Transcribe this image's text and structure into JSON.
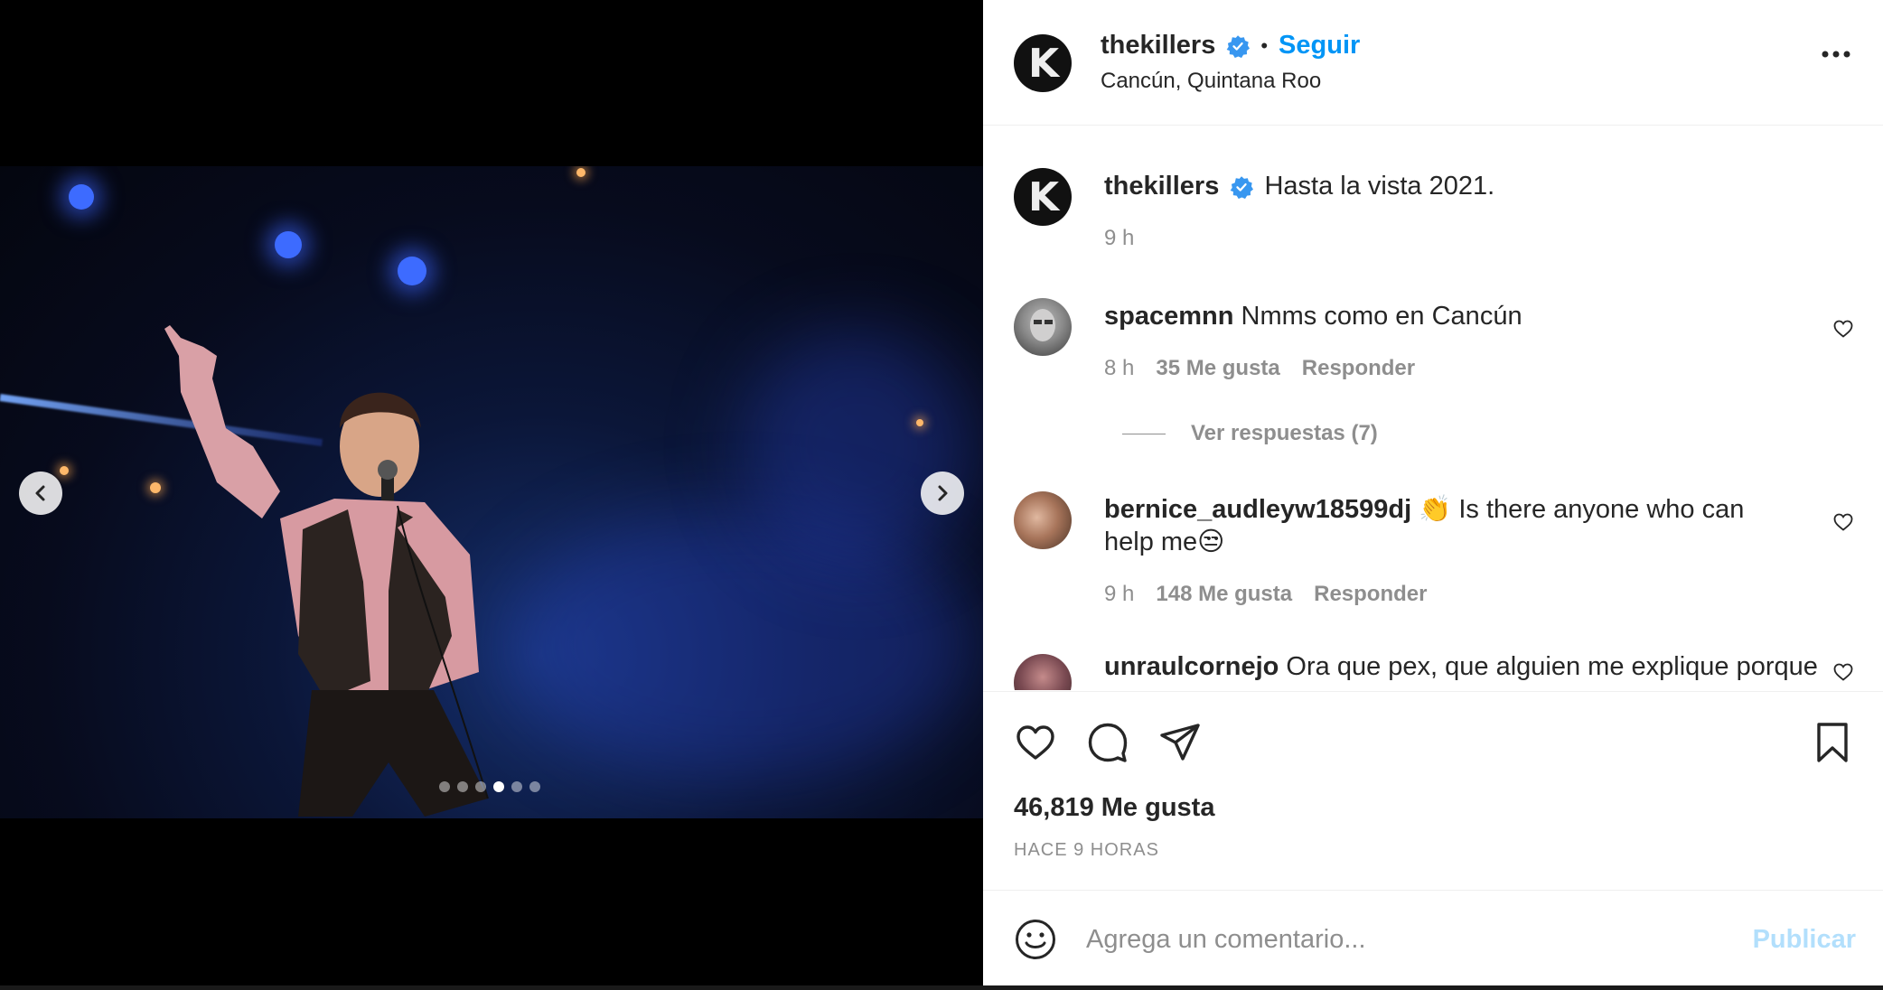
{
  "post": {
    "username": "thekillers",
    "follow_label": "Seguir",
    "separator": "•",
    "location": "Cancún, Quintana Roo",
    "caption": "Hasta la vista 2021.",
    "caption_time": "9 h",
    "avatar_letter": "K",
    "carousel": {
      "total_slides": 6,
      "active_index": 3
    }
  },
  "comments": [
    {
      "username": "spacemnn",
      "text": "Nmms como en Cancún",
      "time": "8 h",
      "likes": "35 Me gusta",
      "reply_label": "Responder",
      "view_replies": "Ver respuestas (7)"
    },
    {
      "username": "bernice_audleyw18599dj",
      "text_prefix": "👏",
      "text": "Is there anyone who can help me😒",
      "time": "9 h",
      "likes": "148 Me gusta",
      "reply_label": "Responder"
    },
    {
      "username": "unraulcornejo",
      "text": "Ora que pex, que alguien me explique porque"
    }
  ],
  "actions": {
    "likes_count": "46,819 Me gusta",
    "time_ago": "HACE 9 HORAS"
  },
  "add_comment": {
    "placeholder": "Agrega un comentario...",
    "publish_label": "Publicar"
  },
  "colors": {
    "accent": "#0095f6",
    "verified": "#3897f0",
    "muted": "#8e8e8e",
    "publish_disabled": "#b2dffc",
    "text": "#262626"
  },
  "icons": [
    "verified-badge-icon",
    "more-options-icon",
    "heart-icon",
    "comment-icon",
    "share-icon",
    "bookmark-icon",
    "emoji-icon",
    "chevron-left-icon",
    "chevron-right-icon"
  ]
}
